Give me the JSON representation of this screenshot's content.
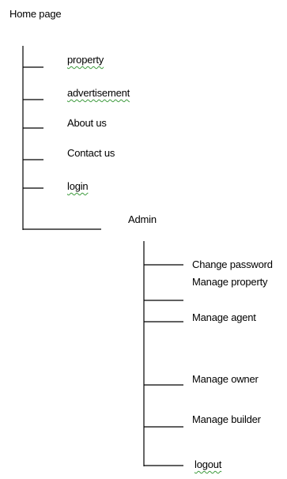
{
  "root": {
    "label": "Home page"
  },
  "home_items": [
    {
      "label": "property",
      "spellcheck_flag": true
    },
    {
      "label": "advertisement",
      "spellcheck_flag": true
    },
    {
      "label": "About us",
      "spellcheck_flag": false
    },
    {
      "label": "Contact us",
      "spellcheck_flag": false
    },
    {
      "label": "login",
      "spellcheck_flag": true
    }
  ],
  "admin": {
    "label": "Admin"
  },
  "admin_items": [
    {
      "label": "Change password",
      "spellcheck_flag": false
    },
    {
      "label": "Manage property",
      "spellcheck_flag": false
    },
    {
      "label": "Manage agent",
      "spellcheck_flag": false
    },
    {
      "label": "Manage owner",
      "spellcheck_flag": false
    },
    {
      "label": "Manage builder",
      "spellcheck_flag": false
    },
    {
      "label": "logout",
      "spellcheck_flag": true
    }
  ],
  "colors": {
    "line": "#000000",
    "text": "#000000",
    "spellcheck_underline": "#3c9a3c"
  }
}
